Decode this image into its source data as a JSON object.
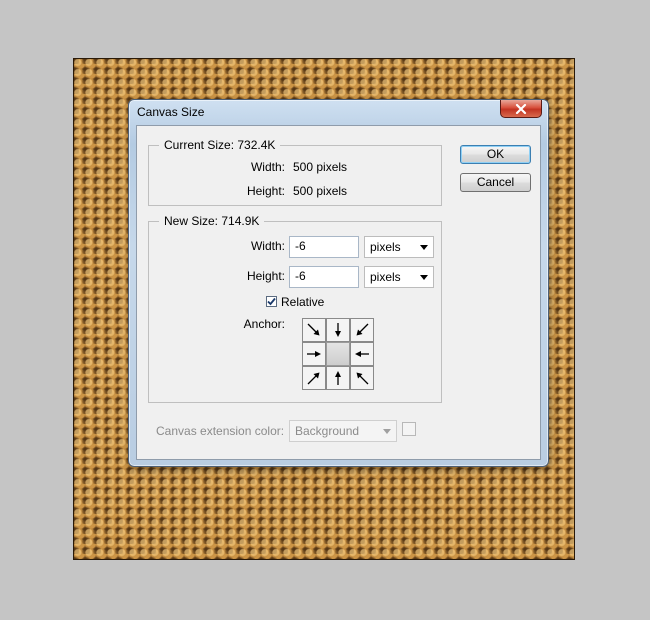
{
  "dialog": {
    "title": "Canvas Size",
    "close_icon": "close-icon",
    "ok_label": "OK",
    "cancel_label": "Cancel"
  },
  "current_size": {
    "legend": "Current Size: 732.4K",
    "width_label": "Width:",
    "width_value": "500 pixels",
    "height_label": "Height:",
    "height_value": "500 pixels"
  },
  "new_size": {
    "legend": "New Size: 714.9K",
    "width_label": "Width:",
    "width_value": "-6",
    "width_unit": "pixels",
    "height_label": "Height:",
    "height_value": "-6",
    "height_unit": "pixels",
    "relative_label": "Relative",
    "relative_checked": true,
    "anchor_label": "Anchor:",
    "anchor_cells": [
      {
        "icon": "arrow-down-right-icon"
      },
      {
        "icon": "arrow-down-icon"
      },
      {
        "icon": "arrow-down-left-icon"
      },
      {
        "icon": "arrow-right-icon"
      },
      {
        "icon": "anchor-center"
      },
      {
        "icon": "arrow-left-icon"
      },
      {
        "icon": "arrow-up-right-icon"
      },
      {
        "icon": "arrow-up-icon"
      },
      {
        "icon": "arrow-up-left-icon"
      }
    ]
  },
  "extension": {
    "label": "Canvas extension color:",
    "value": "Background"
  },
  "colors": {
    "dialog_frame": "#c6d8ea",
    "close_button": "#c23422",
    "client_bg": "#f0f0f0",
    "image_texture": "#9a6e2c"
  }
}
